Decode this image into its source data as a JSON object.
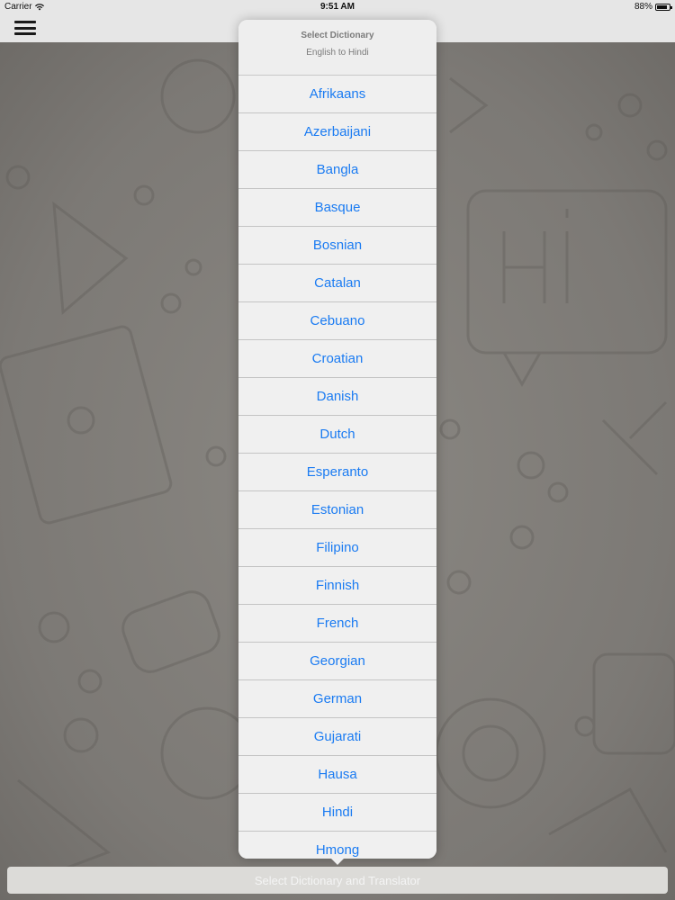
{
  "status_bar": {
    "carrier": "Carrier",
    "time": "9:51 AM",
    "battery": "88%",
    "icons": [
      "wifi-icon",
      "battery-icon"
    ]
  },
  "nav_bar": {
    "menu_icon": "hamburger-menu-icon"
  },
  "popover": {
    "title": "Select Dictionary",
    "subtitle": "English to Hindi",
    "items": [
      "Afrikaans",
      "Azerbaijani",
      "Bangla",
      "Basque",
      "Bosnian",
      "Catalan",
      "Cebuano",
      "Croatian",
      "Danish",
      "Dutch",
      "Esperanto",
      "Estonian",
      "Filipino",
      "Finnish",
      "French",
      "Georgian",
      "German",
      "Gujarati",
      "Hausa",
      "Hindi",
      "Hmong"
    ],
    "item_color": "#1a7bf2"
  },
  "bottom_bar": {
    "label": "Select Dictionary and Translator"
  }
}
